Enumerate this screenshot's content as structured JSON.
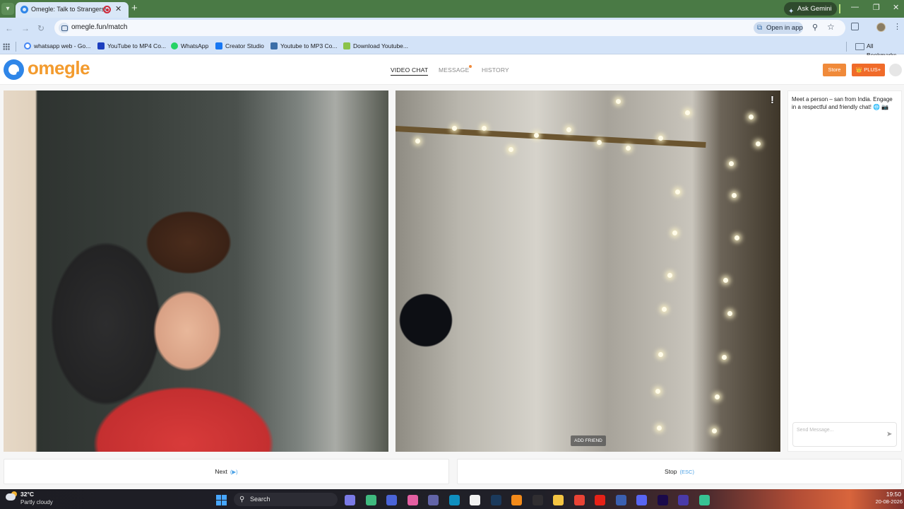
{
  "browser": {
    "tab_title": "Omegle: Talk to Strangers!",
    "url": "omegle.fun/match",
    "ask_gemini_label": "Ask Gemini",
    "open_in_app_label": "Open in app",
    "bookmarks": [
      {
        "label": "whatsapp web - Go...",
        "icon_color": "#ffffff"
      },
      {
        "label": "YouTube to MP4 Co...",
        "icon_color": "#1d3fbf"
      },
      {
        "label": "WhatsApp",
        "icon_color": "#25d366"
      },
      {
        "label": "Creator Studio",
        "icon_color": "#1877f2"
      },
      {
        "label": "Youtube to MP3 Co...",
        "icon_color": "#3b6ea8"
      },
      {
        "label": "Download Youtube...",
        "icon_color": "#8bc34a"
      }
    ],
    "all_bookmarks_label": "All Bookmarks"
  },
  "site": {
    "logo_text": "omegle",
    "brand_color": "#f39b2e",
    "nav": {
      "video_chat": "VIDEO CHAT",
      "message": "MESSAGE",
      "history": "HISTORY"
    },
    "store_label": "Store",
    "plus_label": "👑 PLUS+"
  },
  "video": {
    "add_friend_label": "ADD FRIEND",
    "report_icon": "!"
  },
  "chat": {
    "intro_message": "Meet a person – san from India. Engage in a respectful and friendly chat! 🌐 📷",
    "input_placeholder": "Send Message..."
  },
  "controls": {
    "next_label": "Next",
    "next_hint": "(▶)",
    "stop_label": "Stop",
    "stop_hint": "(ESC)"
  },
  "taskbar": {
    "temperature": "32°C",
    "weather": "Partly cloudy",
    "search_label": "Search",
    "time": "19:50",
    "date": "20-08-2026",
    "apps": [
      {
        "name": "copilot-icon",
        "color": "#7a7ae6"
      },
      {
        "name": "app-multicolor-icon",
        "color": "#3fb97f"
      },
      {
        "name": "messenger-icon",
        "color": "#4a64d8"
      },
      {
        "name": "copilot-app-icon",
        "color": "#e35fa2"
      },
      {
        "name": "teams-icon",
        "color": "#6264a7"
      },
      {
        "name": "edge-icon",
        "color": "#0f8fbf"
      },
      {
        "name": "store-icon",
        "color": "#f2f2f2"
      },
      {
        "name": "steam-icon",
        "color": "#1b3a5c"
      },
      {
        "name": "vlc-icon",
        "color": "#f28a1a"
      },
      {
        "name": "obs-icon",
        "color": "#302e31"
      },
      {
        "name": "file-explorer-icon",
        "color": "#f5c542"
      },
      {
        "name": "chrome-icon",
        "color": "#ea4335"
      },
      {
        "name": "youtube-icon",
        "color": "#e62117"
      },
      {
        "name": "publisher-icon",
        "color": "#3b5fb0"
      },
      {
        "name": "discord-icon",
        "color": "#5865f2"
      },
      {
        "name": "premiere-pro-icon",
        "color": "#1b0a4a"
      },
      {
        "name": "recorder-icon",
        "color": "#4a3aa8"
      },
      {
        "name": "screen-capture-icon",
        "color": "#37c293"
      }
    ]
  }
}
